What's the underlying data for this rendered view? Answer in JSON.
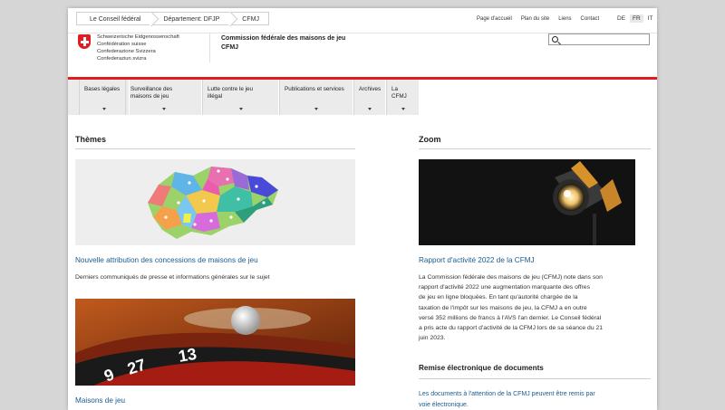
{
  "breadcrumb": [
    "Le Conseil fédéral",
    "Département: DFJP",
    "CFMJ"
  ],
  "top_links": [
    "Page d'accueil",
    "Plan du site",
    "Liens",
    "Contact"
  ],
  "languages": [
    "DE",
    "FR",
    "IT"
  ],
  "active_language": "FR",
  "confederation": [
    "Schweizerische Eidgenossenschaft",
    "Confédération suisse",
    "Confederazione Svizzera",
    "Confederaziun svizra"
  ],
  "org": {
    "line1": "Commission fédérale des maisons de jeu",
    "line2": "CFMJ"
  },
  "search": {
    "placeholder": ""
  },
  "nav": [
    {
      "line1": "Bases légales",
      "line2": ""
    },
    {
      "line1": "Surveillance des",
      "line2": "maisons de jeu"
    },
    {
      "line1": "Lutte contre le jeu",
      "line2": "illégal"
    },
    {
      "line1": "Publications et services",
      "line2": ""
    },
    {
      "line1": "Archives",
      "line2": ""
    },
    {
      "line1": "La CFMJ",
      "line2": ""
    }
  ],
  "themes": {
    "heading": "Thèmes",
    "item1_link": "Nouvelle attribution des concessions de maisons de jeu",
    "item1_text": "Derniers communiqués de presse et informations générales sur le sujet",
    "item2_link": "Maisons de jeu"
  },
  "zoom": {
    "heading": "Zoom",
    "link": "Rapport d'activité 2022 de la CFMJ",
    "body": [
      "La Commission fédérale des maisons de jeu (CFMJ) note dans son",
      "rapport d'activité 2022 une augmentation marquante des offres",
      "de jeu en ligne bloquées. En tant qu'autorité chargée de la",
      "taxation de l'impôt sur les maisons de jeu, la CFMJ a en outre",
      "versé 352 millions de francs à l'AVS l'an dernier. Le Conseil fédéral",
      "a pris acte du rapport d'activité de la CFMJ lors de sa séance du 21",
      "juin 2023."
    ],
    "remise_heading": "Remise électronique de documents",
    "remise_link1": "Les documents à l'attention de la CFMJ peuvent être remis par",
    "remise_link2": "voie électronique."
  },
  "colors": {
    "accent": "#e01c23",
    "link": "#1a5b8f"
  }
}
